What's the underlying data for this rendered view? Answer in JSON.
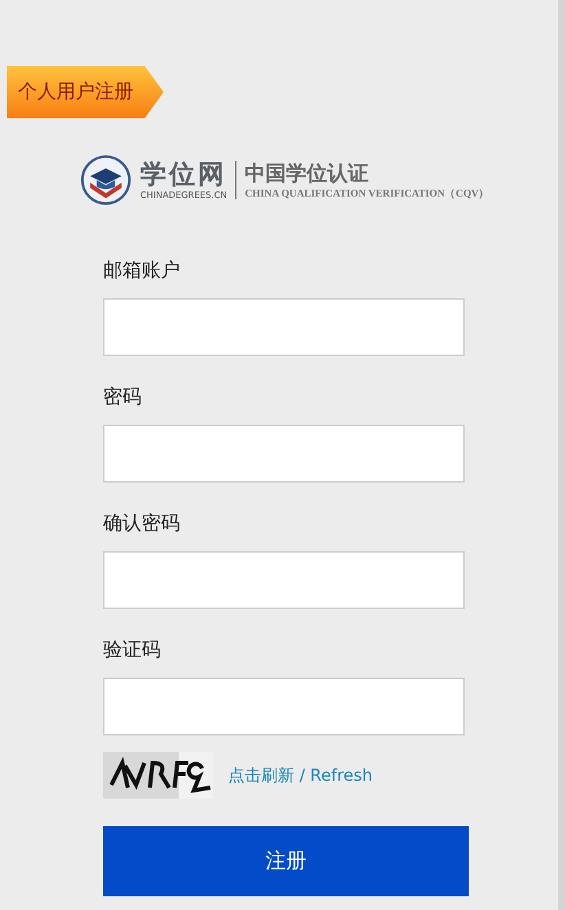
{
  "tab": {
    "label": "个人用户注册"
  },
  "logo": {
    "name": "学位网",
    "domain": "CHINADEGREES.CN",
    "title": "中国学位认证",
    "subtitle": "CHINA QUALIFICATION VERIFICATION（CQV）"
  },
  "fields": [
    {
      "label": "邮箱账户"
    },
    {
      "label": "密码"
    },
    {
      "label": "确认密码"
    },
    {
      "label": "验证码"
    }
  ],
  "captcha": {
    "kind": "picture",
    "refresh": "点击刷新 / Refresh"
  },
  "submit": "注册"
}
